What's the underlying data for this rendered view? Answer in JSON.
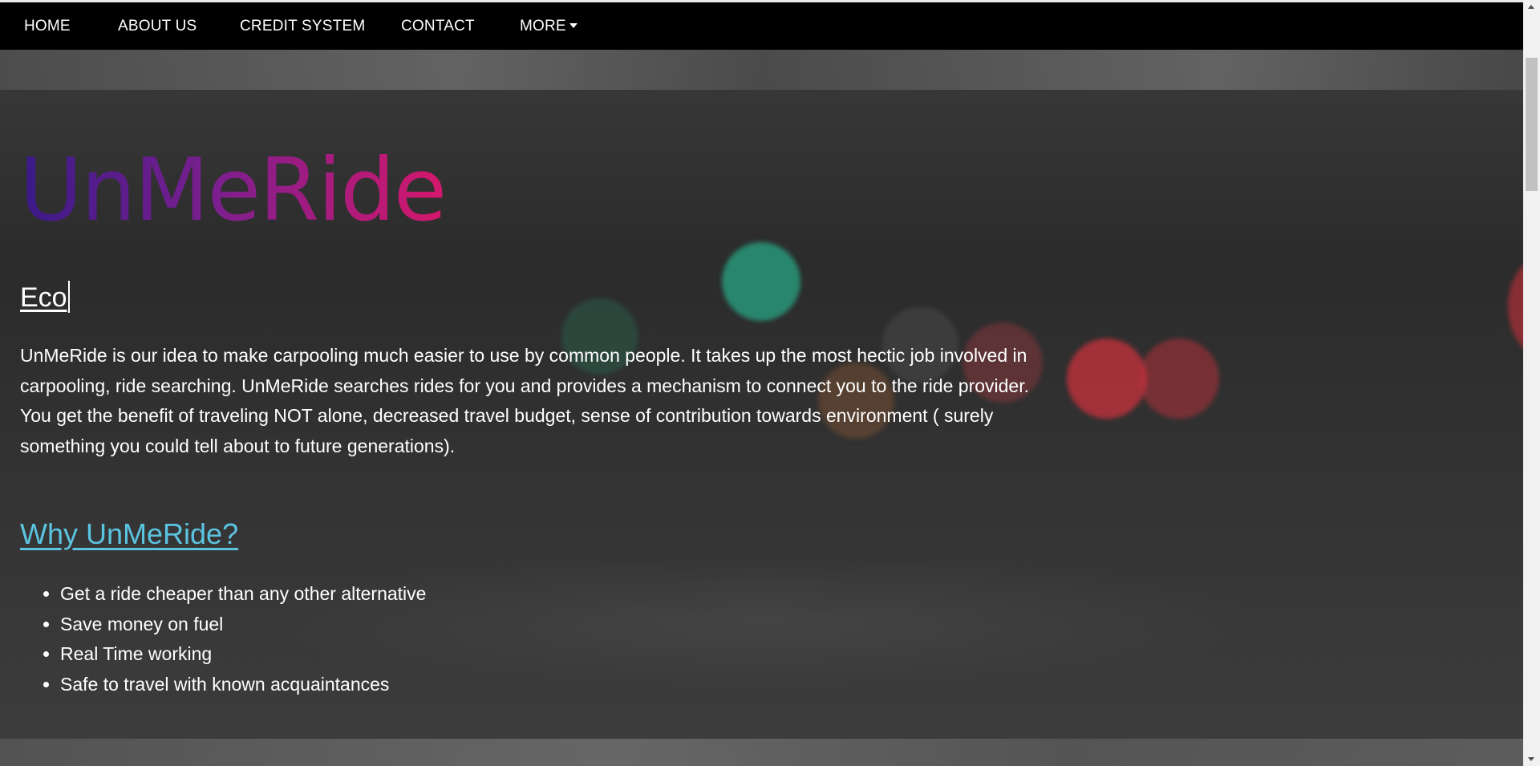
{
  "nav": {
    "items": [
      {
        "label": "HOME"
      },
      {
        "label": "ABOUT US"
      },
      {
        "label": "CREDIT SYSTEM"
      },
      {
        "label": "CONTACT"
      },
      {
        "label": "MORE"
      }
    ]
  },
  "hero": {
    "brand": "UnMeRide",
    "typed_text": "Eco",
    "intro": "UnMeRide is our idea to make carpooling much easier to use by common people. It takes up the most hectic job involved in carpooling, ride searching. UnMeRide searches rides for you and provides a mechanism to connect you to the ride provider. You get the benefit of traveling NOT alone, decreased travel budget, sense of contribution towards environment ( surely something you could tell about to future generations)."
  },
  "why": {
    "heading": "Why UnMeRide?",
    "items": [
      "Get a ride cheaper than any other alternative",
      "Save money on fuel",
      "Real Time working",
      "Safe to travel with known acquaintances"
    ]
  },
  "colors": {
    "navbar": "#000000",
    "brand_gradient_start": "#3a1a87",
    "brand_gradient_end": "#d4186c",
    "link": "#5bc4e0",
    "text": "#ffffff"
  },
  "icons": {
    "more_caret": "caret-down-icon"
  }
}
